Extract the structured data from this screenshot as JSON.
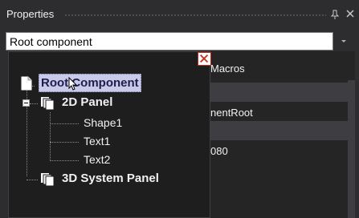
{
  "panel": {
    "title": "Properties"
  },
  "component_selector": {
    "value": "Root component"
  },
  "tree": {
    "items": [
      {
        "label": "Root Component",
        "selected": true,
        "icon": "document-icon"
      },
      {
        "label": "2D Panel",
        "expanded": true,
        "icon": "panel-stack-icon"
      },
      {
        "label": "Shape1"
      },
      {
        "label": "Text1"
      },
      {
        "label": "Text2"
      },
      {
        "label": "3D System Panel",
        "icon": "panel-stack-icon"
      }
    ]
  },
  "property_grid_partial": {
    "macros_label": "Macros",
    "name_value_partial": "nentRoot",
    "number_value_partial": "080"
  },
  "colors": {
    "panel_bg": "#2d2d30",
    "popup_bg": "#1e1e1e",
    "selection_bg": "#c9c9e8",
    "close_red": "#c42b1c"
  }
}
